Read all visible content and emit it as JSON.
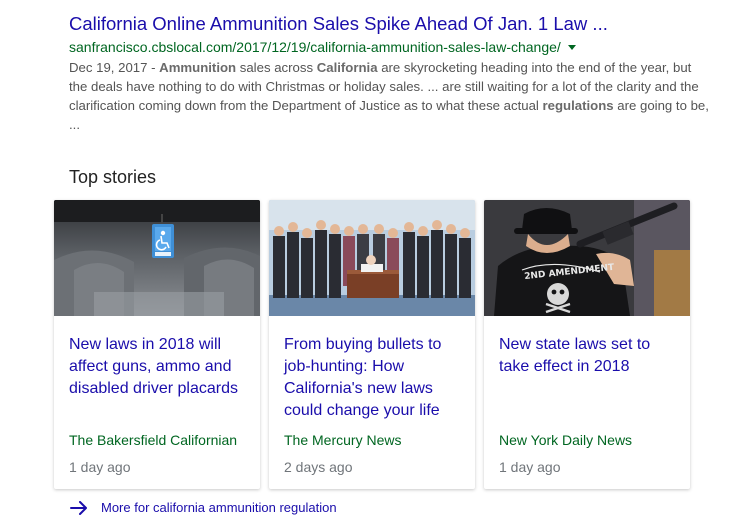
{
  "result": {
    "title": "California Online Ammunition Sales Spike Ahead Of Jan. 1 Law ...",
    "url": "sanfrancisco.cbslocal.com/2017/12/19/california-ammunition-sales-law-change/",
    "snippet": {
      "date": "Dec 19, 2017 - ",
      "b1": "Ammunition",
      "t1": " sales across ",
      "b2": "California",
      "t2": " are skyrocketing heading into the end of the year, but the deals have nothing to do with Christmas or holiday sales. ... are still waiting for a lot of the clarity and the clarification coming down from the Department of Justice as to what these actual ",
      "b3": "regulations",
      "t3": " are going to be, ..."
    }
  },
  "top_stories": {
    "heading": "Top stories",
    "cards": [
      {
        "title": "New laws in 2018 will affect guns, ammo and disabled driver placards",
        "source": "The Bakersfield Californian",
        "time": "1 day ago",
        "image": "car-interior-disabled-placard"
      },
      {
        "title": "From buying bullets to job-hunting: How California's new laws could change your life",
        "source": "The Mercury News",
        "time": "2 days ago",
        "image": "bill-signing-ceremony"
      },
      {
        "title": "New state laws set to take effect in 2018",
        "source": "New York Daily News",
        "time": "1 day ago",
        "image": "man-with-rifle-2nd-amendment-shirt",
        "image_text": "2ND AMENDMENT"
      }
    ],
    "more_link": "More for california ammunition regulation"
  },
  "colors": {
    "link": "#1a0dab",
    "url_green": "#006621",
    "snippet": "#545454",
    "meta": "#70757a"
  }
}
